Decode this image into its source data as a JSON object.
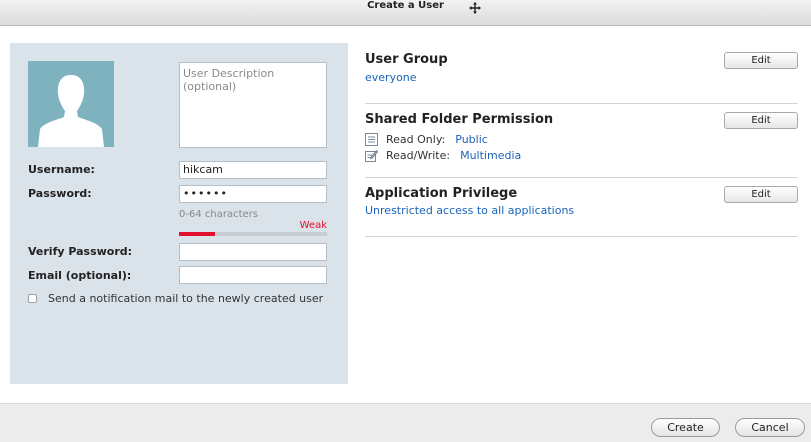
{
  "window": {
    "title": "Create a User",
    "move_icon": "move-cross-icon"
  },
  "form": {
    "description_placeholder": "User Description (optional)",
    "username_label": "Username:",
    "username_value": "hikcam",
    "password_label": "Password:",
    "password_value": "••••••",
    "password_hint": "0-64 characters",
    "password_strength_label": "Weak",
    "password_strength_fraction": 0.24,
    "verify_label": "Verify Password:",
    "verify_value": "",
    "email_label": "Email (optional):",
    "email_value": "",
    "notify_label": "Send a notification mail to the newly created user",
    "notify_checked": false
  },
  "user_group": {
    "title": "User Group",
    "value": "everyone",
    "edit_label": "Edit"
  },
  "shared_folder": {
    "title": "Shared Folder Permission",
    "edit_label": "Edit",
    "read_only_label": "Read Only:",
    "read_only_value": "Public",
    "read_write_label": "Read/Write:",
    "read_write_value": "Multimedia"
  },
  "app_privilege": {
    "title": "Application Privilege",
    "value": "Unrestricted access to all applications",
    "edit_label": "Edit"
  },
  "footer": {
    "create_label": "Create",
    "cancel_label": "Cancel"
  },
  "colors": {
    "link": "#1a63b8",
    "weak": "#e0102e",
    "panel": "#dbe3ea",
    "avatar": "#7fb2bf"
  }
}
